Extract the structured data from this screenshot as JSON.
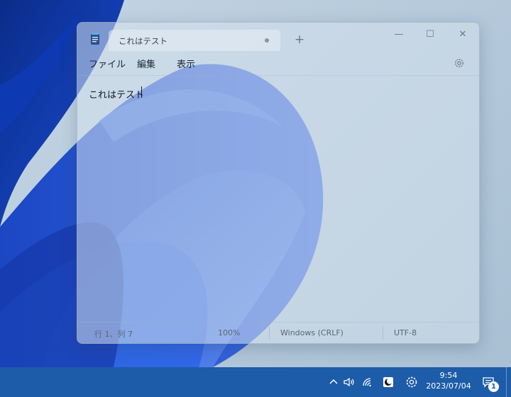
{
  "window": {
    "tab_title": "これはテスト",
    "new_tab": "+",
    "minimize": "—",
    "maximize": "☐",
    "close": "✕"
  },
  "menu": {
    "file": "ファイル",
    "edit": "編集",
    "view": "表示",
    "settings_icon": "gear-icon"
  },
  "editor": {
    "content": "これはテスト"
  },
  "statusbar": {
    "position": "行 1、列 7",
    "zoom": "100%",
    "line_ending": "Windows (CRLF)",
    "encoding": "UTF-8"
  },
  "taskbar": {
    "time": "9:54",
    "date": "2023/07/04",
    "notification_count": "1",
    "tray_icons": [
      "chevron-up-icon",
      "volume-icon",
      "wifi-icon",
      "night-light-icon",
      "gear-icon"
    ]
  },
  "colors": {
    "taskbar": "#1d5ca8",
    "wallpaper_bloom": "#1d4fd0",
    "desktop_background": "#c5d6e4"
  }
}
